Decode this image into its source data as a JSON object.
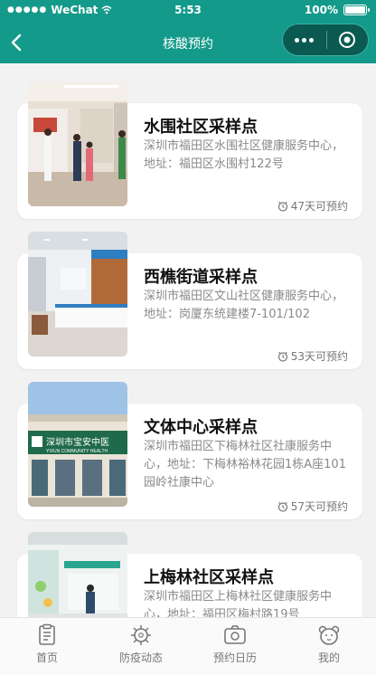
{
  "status": {
    "carrier": "WeChat",
    "time": "5:53",
    "battery": "100%"
  },
  "nav": {
    "title": "核酸预约"
  },
  "cards": [
    {
      "title": "水围社区采样点",
      "desc": "深圳市福田区水围社区健康服务中心，地址：福田区水围村122号",
      "days": "47天可预约"
    },
    {
      "title": "西樵街道采样点",
      "desc": "深圳市福田区文山社区健康服务中心，地址：岗厦东统建楼7-101/102",
      "days": "53天可预约"
    },
    {
      "title": "文体中心采样点",
      "desc": "深圳市福田区下梅林社区社康服务中心，地址：下梅林裕林花园1栋A座101园岭社康中心",
      "days": "57天可预约",
      "sign_text": "深圳市宝安中医",
      "sign_sub": "YIXUN COMMUNITY HEALTH"
    },
    {
      "title": "上梅林社区采样点",
      "desc": "深圳市福田区上梅林社区健康服务中心，地址：福田区梅村路19号",
      "days": ""
    }
  ],
  "tabs": [
    {
      "label": "首页",
      "icon": "document-icon"
    },
    {
      "label": "防疫动态",
      "icon": "virus-icon"
    },
    {
      "label": "预约日历",
      "icon": "camera-icon"
    },
    {
      "label": "我的",
      "icon": "bear-icon"
    }
  ],
  "colors": {
    "theme": "#149a8a",
    "capsule": "#0b5a52"
  }
}
